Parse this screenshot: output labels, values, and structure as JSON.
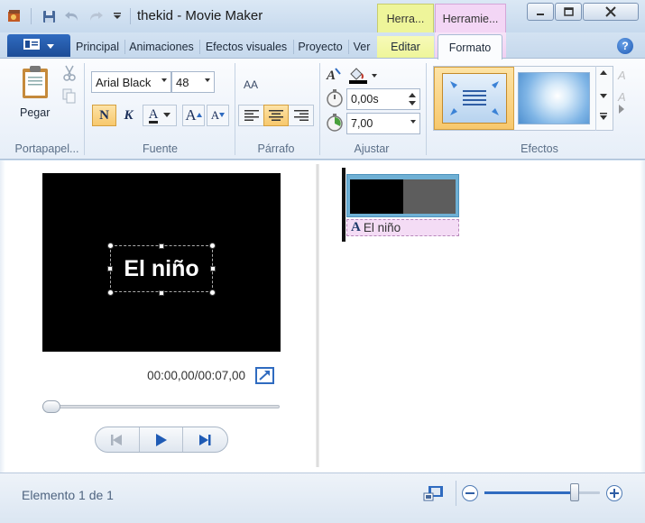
{
  "window": {
    "title": "thekid - Movie Maker",
    "context_headers": [
      "Herra...",
      "Herramie..."
    ],
    "context_colors": [
      "#eef59a",
      "#f3d6f5"
    ]
  },
  "tabs": [
    "Principal",
    "Animaciones",
    "Efectos visuales",
    "Proyecto",
    "Ver",
    "Editar",
    "Formato"
  ],
  "ribbon": {
    "clipboard": {
      "paste_label": "Pegar",
      "group_label": "Portapapel..."
    },
    "font": {
      "family": "Arial Black",
      "size": "48",
      "bold_label": "N",
      "italic_label": "K",
      "color_label": "A",
      "grow_label": "A",
      "shrink_label": "A",
      "group_label": "Fuente"
    },
    "paragraph": {
      "group_label": "Párrafo",
      "aa_label": "AA"
    },
    "adjust": {
      "start_time": "0,00s",
      "duration": "7,00",
      "group_label": "Ajustar"
    },
    "effects": {
      "group_label": "Efectos"
    }
  },
  "preview": {
    "caption_text": "El niño",
    "time_display": "00:00,00/00:07,00",
    "progress": 0
  },
  "storyboard": {
    "caption_item_label": "El niño",
    "caption_icon": "A"
  },
  "status": {
    "text": "Elemento 1 de 1",
    "zoom_level": 0.78
  },
  "colors": {
    "accent_blue": "#1d4c96",
    "selected_orange": "#f7c86d",
    "caption_pink": "#f4dcf5"
  }
}
